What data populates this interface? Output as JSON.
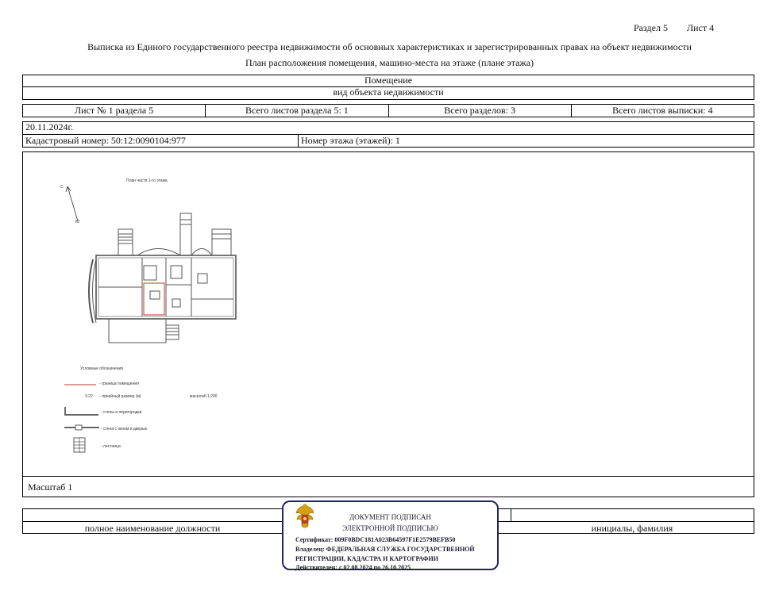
{
  "header": {
    "section": "Раздел 5",
    "sheet": "Лист 4",
    "title_line1": "Выписка из Единого государственного реестра недвижимости об основных характеристиках и зарегистрированных правах на объект недвижимости",
    "title_line2": "План расположения помещения, машино-места на этаже (плане этажа)"
  },
  "object": {
    "type_value": "Помещение",
    "type_caption": "вид объекта недвижимости"
  },
  "sheet_info": {
    "sheet_of_section": "Лист № 1 раздела 5",
    "total_sheets_section": "Всего листов раздела 5: 1",
    "total_sections": "Всего разделов: 3",
    "total_sheets_extract": "Всего листов выписки: 4"
  },
  "date": "20.11.2024г.",
  "cadastral": "Кадастровый номер: 50:12:0090104:977",
  "floor": "Номер этажа (этажей): 1",
  "plan": {
    "title": "План части 1-го этажа",
    "compass_north": "С",
    "compass_south": "Ю",
    "legend_title": "Условные обозначения",
    "legend_border": "- граница помещения",
    "legend_dim_value": "3.22",
    "legend_dim": "- линейный размер (м)",
    "legend_scale": "масштаб 1:200",
    "legend_walls": "- стены и перегородки",
    "legend_windows": "- стена с окном и дверью",
    "legend_stairs": "- лестница",
    "scale_label": "Масштаб 1"
  },
  "signature": {
    "position_caption": "полное наименование должности",
    "name_caption": "инициалы, фамилия"
  },
  "stamp": {
    "line1": "ДОКУМЕНТ ПОДПИСАН",
    "line2": "ЭЛЕКТРОННОЙ ПОДПИСЬЮ",
    "cert": "Сертификат: 009F0BDC181A023B64597F1E2579BEFB50",
    "owner1": "Владелец: ФЕДЕРАЛЬНАЯ СЛУЖБА ГОСУДАРСТВЕННОЙ",
    "owner2": "РЕГИСТРАЦИИ, КАДАСТРА И КАРТОГРАФИИ",
    "valid": "Действителен: с 02.08.2024 по 26.10.2025",
    "border_color": "#22245e"
  }
}
